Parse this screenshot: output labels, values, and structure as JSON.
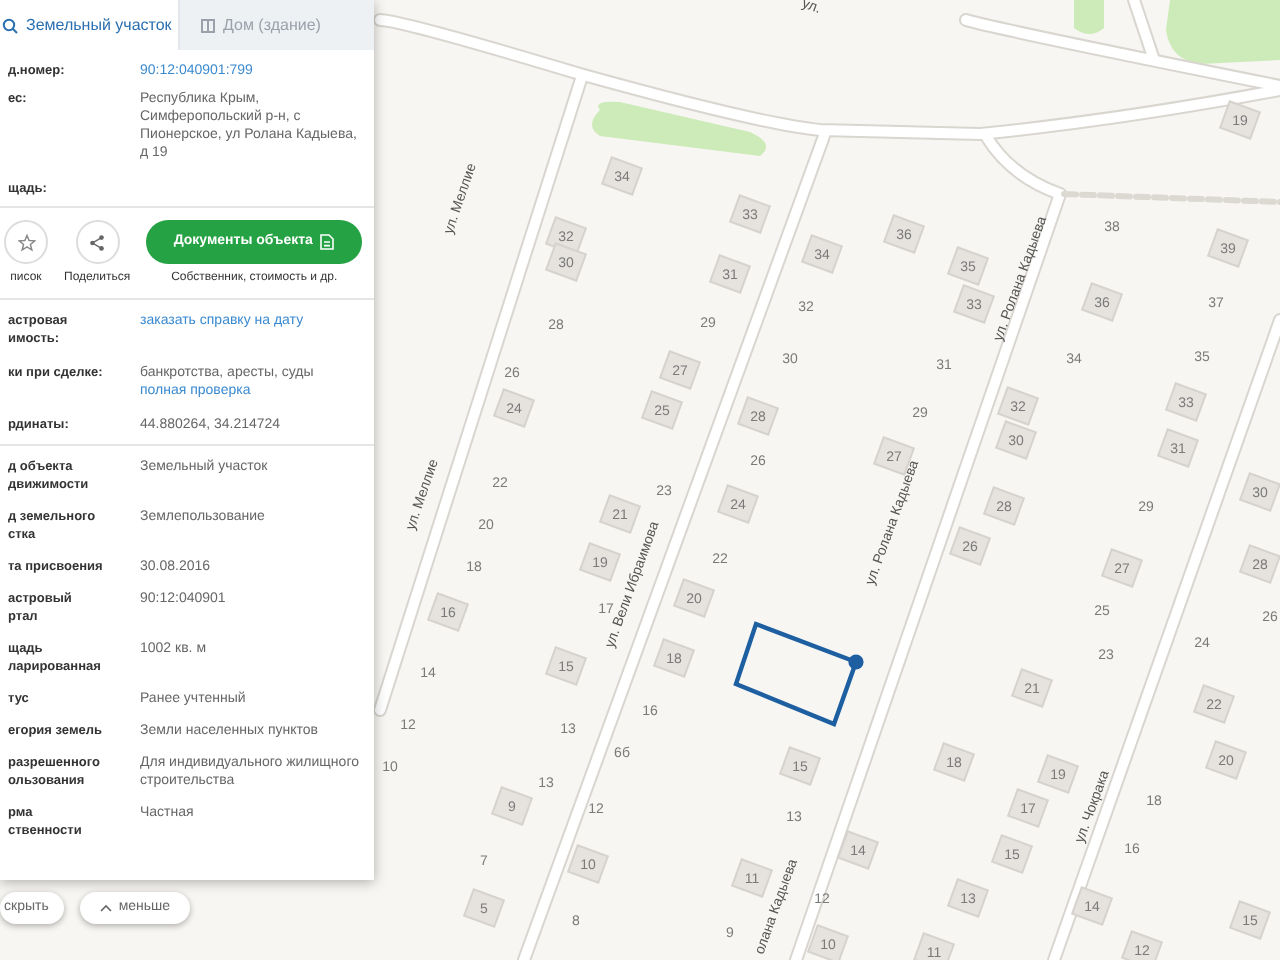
{
  "panel": {
    "tabs": [
      {
        "label": "Земельный участок",
        "selected": true
      },
      {
        "label": "Дом (здание)",
        "selected": false
      }
    ],
    "top_fields": [
      {
        "label": "д.номер:",
        "values": [
          {
            "kind": "link",
            "text": "90:12:040901:799"
          }
        ]
      },
      {
        "label": "ес:",
        "values": [
          {
            "kind": "text",
            "text": "Республика Крым, Симферопольский р-н, с Пионерское, ул Ролана Кадыева, д 19"
          }
        ]
      },
      {
        "label": "щадь:"
      }
    ],
    "actions": {
      "icon_buttons": [
        {
          "kind": "star",
          "caption": "писок"
        },
        {
          "kind": "share",
          "caption": "Поделиться"
        }
      ],
      "primary_button": "Документы объекта",
      "primary_caption": "Собственник, стоимость и др."
    },
    "fields": [
      {
        "label": "астровая\nимость:",
        "values": [
          {
            "kind": "link",
            "text": "заказать справку на дату"
          }
        ]
      },
      {
        "label": "ки при сделке:",
        "values": [
          {
            "kind": "text",
            "text": "банкротства, аресты, суды"
          },
          {
            "kind": "link",
            "text": "полная проверка"
          }
        ]
      },
      {
        "label": "рдинаты:",
        "values": [
          {
            "kind": "text",
            "text": "44.880264, 34.214724"
          }
        ]
      }
    ],
    "more_fields": [
      {
        "label": "д объекта\nдвижимости",
        "values": [
          {
            "kind": "text",
            "text": "Земельный участок"
          }
        ]
      },
      {
        "label": "д земельного\nстка",
        "values": [
          {
            "kind": "text",
            "text": "Землепользование"
          }
        ]
      },
      {
        "label": "та присвоения",
        "values": [
          {
            "kind": "text",
            "text": "30.08.2016"
          }
        ]
      },
      {
        "label": "астровый\nртал",
        "values": [
          {
            "kind": "text",
            "text": "90:12:040901"
          }
        ]
      },
      {
        "label": "щадь\nларированная",
        "values": [
          {
            "kind": "text",
            "text": "1002 кв. м"
          }
        ]
      },
      {
        "label": "тус",
        "values": [
          {
            "kind": "text",
            "text": "Ранее учтенный"
          }
        ]
      },
      {
        "label": "егория земель",
        "values": [
          {
            "kind": "text",
            "text": "Земли населенных пунктов"
          }
        ]
      },
      {
        "label": "разрешенного\nользования",
        "values": [
          {
            "kind": "text",
            "text": "Для индивидуального жилищного строительства"
          }
        ]
      },
      {
        "label": "рма\nственности",
        "values": [
          {
            "kind": "text",
            "text": "Частная"
          }
        ]
      }
    ],
    "footer_buttons": [
      {
        "kind": "hide",
        "label": "скрыть"
      },
      {
        "kind": "less",
        "label": "меньше"
      }
    ]
  },
  "map": {
    "street_labels": [
      "ул.",
      "ул. Меллие",
      "ул. Меллие",
      "ул. Вели Ибраимова",
      "ул. Ролана Кадыева",
      "ул. Ролана Кадыева",
      "олана Кадыева",
      "ул. Чокрака"
    ],
    "house_numbers": [
      "34",
      "33",
      "32",
      "30",
      "31",
      "28",
      "29",
      "26",
      "27",
      "24",
      "25",
      "19",
      "34",
      "36",
      "35",
      "32",
      "33",
      "30",
      "31",
      "28",
      "29",
      "26",
      "27",
      "38",
      "39",
      "36",
      "37",
      "34",
      "35",
      "32",
      "30",
      "33",
      "31",
      "23",
      "24",
      "22",
      "20",
      "21",
      "18",
      "19",
      "22",
      "20",
      "16",
      "17",
      "15",
      "18",
      "14",
      "13",
      "16",
      "12",
      "10",
      "6б",
      "13",
      "9",
      "12",
      "7",
      "10",
      "5",
      "8",
      "15",
      "13",
      "11",
      "14",
      "12",
      "9",
      "10",
      "28",
      "26",
      "29",
      "27",
      "30",
      "28",
      "25",
      "23",
      "26",
      "24",
      "21",
      "22",
      "18",
      "19",
      "20",
      "17",
      "18",
      "15",
      "16",
      "13",
      "14",
      "15",
      "11",
      "12"
    ]
  }
}
